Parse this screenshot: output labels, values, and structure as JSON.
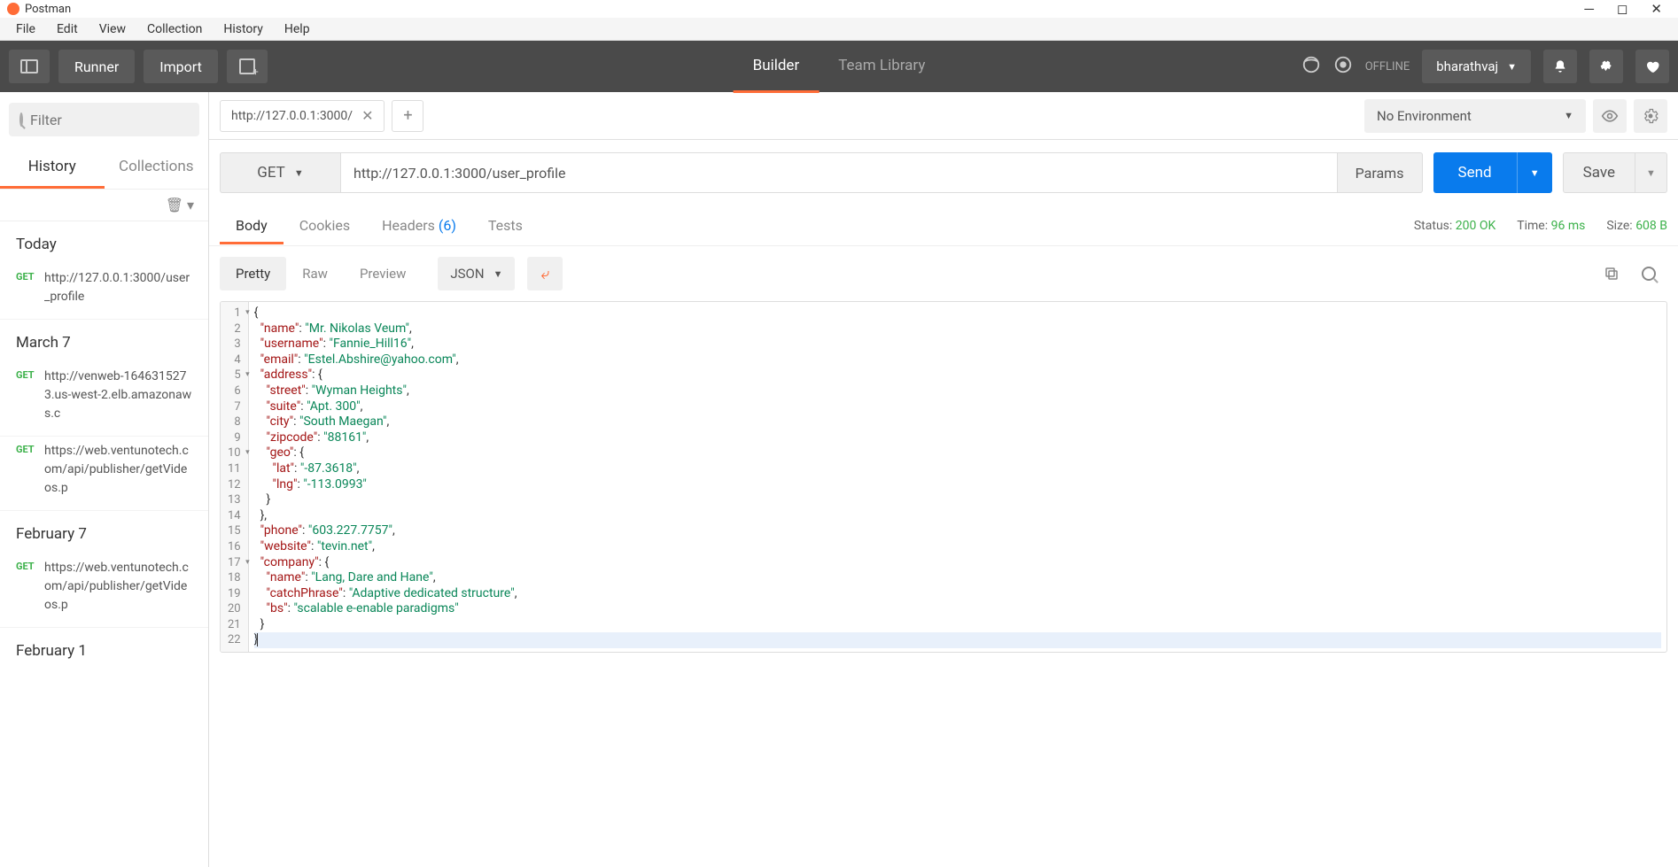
{
  "titlebar": {
    "app_name": "Postman"
  },
  "menubar": {
    "file": "File",
    "edit": "Edit",
    "view": "View",
    "collection": "Collection",
    "history": "History",
    "help": "Help"
  },
  "toolbar": {
    "runner": "Runner",
    "import": "Import",
    "tab_builder": "Builder",
    "tab_team": "Team Library",
    "offline": "OFFLINE",
    "user": "bharathvaj"
  },
  "sidebar": {
    "filter_placeholder": "Filter",
    "tab_history": "History",
    "tab_collections": "Collections",
    "groups": [
      {
        "date": "Today",
        "items": [
          {
            "method": "GET",
            "url": "http://127.0.0.1:3000/user_profile"
          }
        ]
      },
      {
        "date": "March 7",
        "items": [
          {
            "method": "GET",
            "url": "http://venweb-1646315273.us-west-2.elb.amazonaws.c"
          },
          {
            "method": "GET",
            "url": "https://web.ventunotech.com/api/publisher/getVideos.p"
          }
        ]
      },
      {
        "date": "February 7",
        "items": [
          {
            "method": "GET",
            "url": "https://web.ventunotech.com/api/publisher/getVideos.p"
          }
        ]
      },
      {
        "date": "February 1",
        "items": []
      }
    ]
  },
  "request": {
    "tab_title": "http://127.0.0.1:3000/",
    "env_label": "No Environment",
    "method": "GET",
    "url": "http://127.0.0.1:3000/user_profile",
    "params_btn": "Params",
    "send_btn": "Send",
    "save_btn": "Save"
  },
  "response": {
    "tabs": {
      "body": "Body",
      "cookies": "Cookies",
      "headers": "Headers",
      "headers_count": "(6)",
      "tests": "Tests"
    },
    "status_label": "Status:",
    "status_value": "200 OK",
    "time_label": "Time:",
    "time_value": "96 ms",
    "size_label": "Size:",
    "size_value": "608 B",
    "view": {
      "pretty": "Pretty",
      "raw": "Raw",
      "preview": "Preview",
      "format": "JSON"
    },
    "body": {
      "name": "Mr. Nikolas Veum",
      "username": "Fannie_Hill16",
      "email": "Estel.Abshire@yahoo.com",
      "address": {
        "street": "Wyman Heights",
        "suite": "Apt. 300",
        "city": "South Maegan",
        "zipcode": "88161",
        "geo": {
          "lat": "-87.3618",
          "lng": "-113.0993"
        }
      },
      "phone": "603.227.7757",
      "website": "tevin.net",
      "company": {
        "name": "Lang, Dare and Hane",
        "catchPhrase": "Adaptive dedicated structure",
        "bs": "scalable e-enable paradigms"
      }
    }
  }
}
